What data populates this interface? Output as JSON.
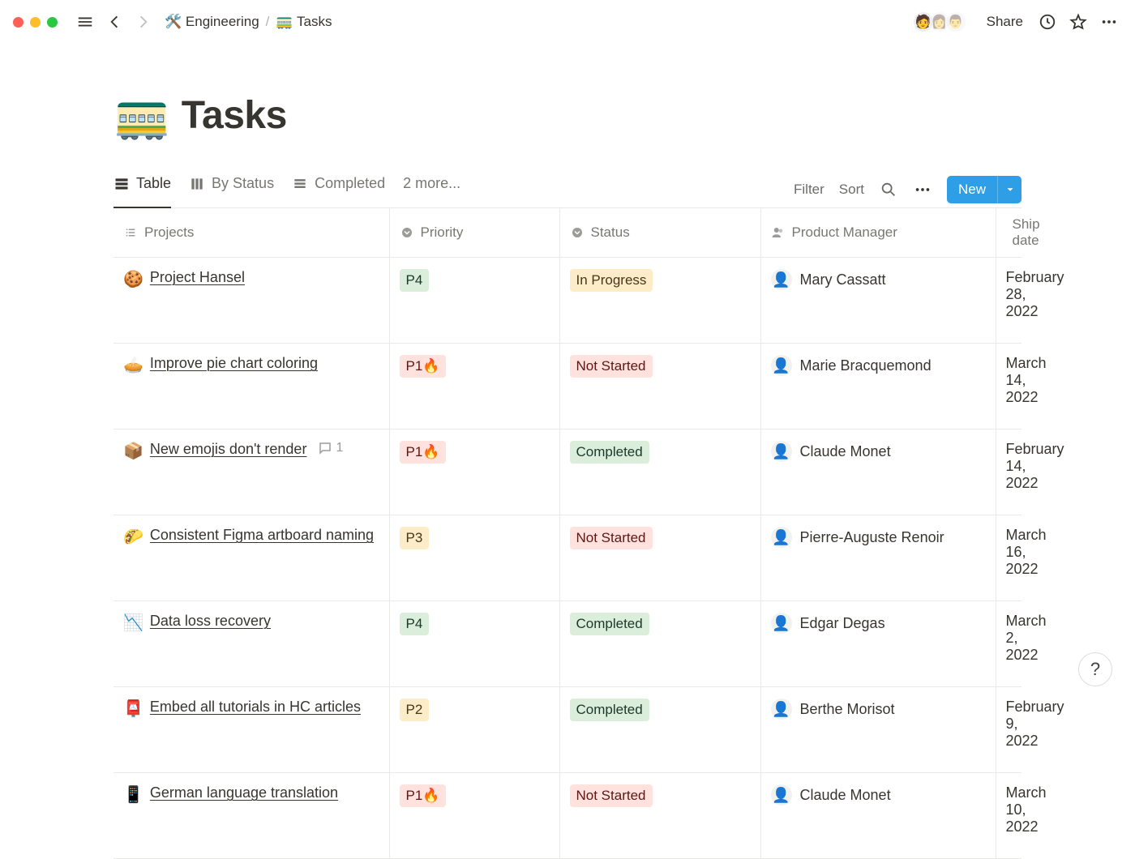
{
  "topbar": {
    "breadcrumb": [
      {
        "icon": "🛠️",
        "label": "Engineering"
      },
      {
        "icon": "🚃",
        "label": "Tasks"
      }
    ],
    "share_label": "Share"
  },
  "page": {
    "icon": "🚃",
    "title": "Tasks"
  },
  "views": {
    "tabs": [
      {
        "label": "Table",
        "icon": "table",
        "active": true
      },
      {
        "label": "By Status",
        "icon": "board",
        "active": false
      },
      {
        "label": "Completed",
        "icon": "list",
        "active": false
      }
    ],
    "more_label": "2 more...",
    "filter_label": "Filter",
    "sort_label": "Sort",
    "new_label": "New"
  },
  "columns": [
    {
      "key": "projects",
      "label": "Projects",
      "icon": "text"
    },
    {
      "key": "priority",
      "label": "Priority",
      "icon": "select"
    },
    {
      "key": "status",
      "label": "Status",
      "icon": "select"
    },
    {
      "key": "pm",
      "label": "Product Manager",
      "icon": "person"
    },
    {
      "key": "shipdate",
      "label": "Ship date",
      "icon": "date"
    }
  ],
  "rows": [
    {
      "emoji": "🍪",
      "title": "Project Hansel",
      "comments": null,
      "priority": {
        "text": "P4",
        "color": "green",
        "fire": false
      },
      "status": {
        "text": "In Progress",
        "color": "yellow-bg"
      },
      "pm": "Mary Cassatt",
      "date": "February 28, 2022"
    },
    {
      "emoji": "🥧",
      "title": "Improve pie chart coloring",
      "comments": null,
      "priority": {
        "text": "P1",
        "color": "red",
        "fire": true
      },
      "status": {
        "text": "Not Started",
        "color": "red"
      },
      "pm": "Marie Bracquemond",
      "date": "March 14, 2022"
    },
    {
      "emoji": "📦",
      "title": "New emojis don't render",
      "comments": 1,
      "priority": {
        "text": "P1",
        "color": "red",
        "fire": true
      },
      "status": {
        "text": "Completed",
        "color": "green"
      },
      "pm": "Claude Monet",
      "date": "February 14, 2022"
    },
    {
      "emoji": "🌮",
      "title": "Consistent Figma artboard naming",
      "comments": null,
      "priority": {
        "text": "P3",
        "color": "orange",
        "fire": false
      },
      "status": {
        "text": "Not Started",
        "color": "red"
      },
      "pm": "Pierre-Auguste Renoir",
      "date": "March 16, 2022"
    },
    {
      "emoji": "📉",
      "title": "Data loss recovery",
      "comments": null,
      "priority": {
        "text": "P4",
        "color": "green",
        "fire": false
      },
      "status": {
        "text": "Completed",
        "color": "green"
      },
      "pm": "Edgar Degas",
      "date": "March 2, 2022"
    },
    {
      "emoji": "📮",
      "title": "Embed all tutorials in HC articles",
      "comments": null,
      "priority": {
        "text": "P2",
        "color": "orange",
        "fire": false
      },
      "status": {
        "text": "Completed",
        "color": "green"
      },
      "pm": "Berthe Morisot",
      "date": "February 9, 2022"
    },
    {
      "emoji": "📱",
      "title": "German language translation",
      "comments": null,
      "priority": {
        "text": "P1",
        "color": "red",
        "fire": true
      },
      "status": {
        "text": "Not Started",
        "color": "red"
      },
      "pm": "Claude Monet",
      "date": "March 10, 2022"
    }
  ],
  "help_label": "?"
}
